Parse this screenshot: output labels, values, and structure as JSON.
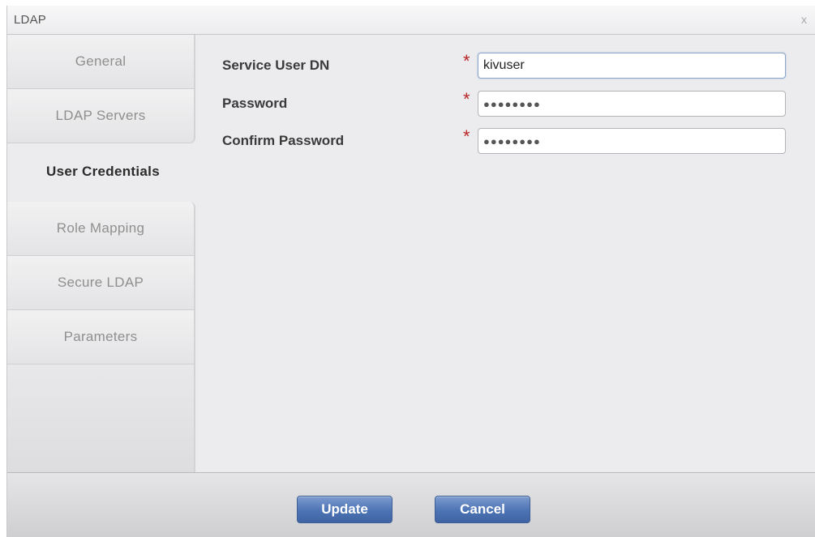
{
  "dialog": {
    "title": "LDAP",
    "close_label": "x"
  },
  "sidebar": {
    "items": [
      {
        "label": "General",
        "active": false
      },
      {
        "label": "LDAP Servers",
        "active": false
      },
      {
        "label": "User Credentials",
        "active": true
      },
      {
        "label": "Role Mapping",
        "active": false
      },
      {
        "label": "Secure LDAP",
        "active": false
      },
      {
        "label": "Parameters",
        "active": false
      }
    ]
  },
  "form": {
    "required_marker": "*",
    "fields": [
      {
        "label": "Service User DN",
        "value": "kivuser",
        "type": "text"
      },
      {
        "label": "Password",
        "value": "●●●●●●●●",
        "type": "password"
      },
      {
        "label": "Confirm Password",
        "value": "●●●●●●●●",
        "type": "password"
      }
    ]
  },
  "footer": {
    "update_label": "Update",
    "cancel_label": "Cancel"
  },
  "colors": {
    "required": "#b9272a",
    "button": "#4c73b4",
    "panel": "#ececee"
  }
}
